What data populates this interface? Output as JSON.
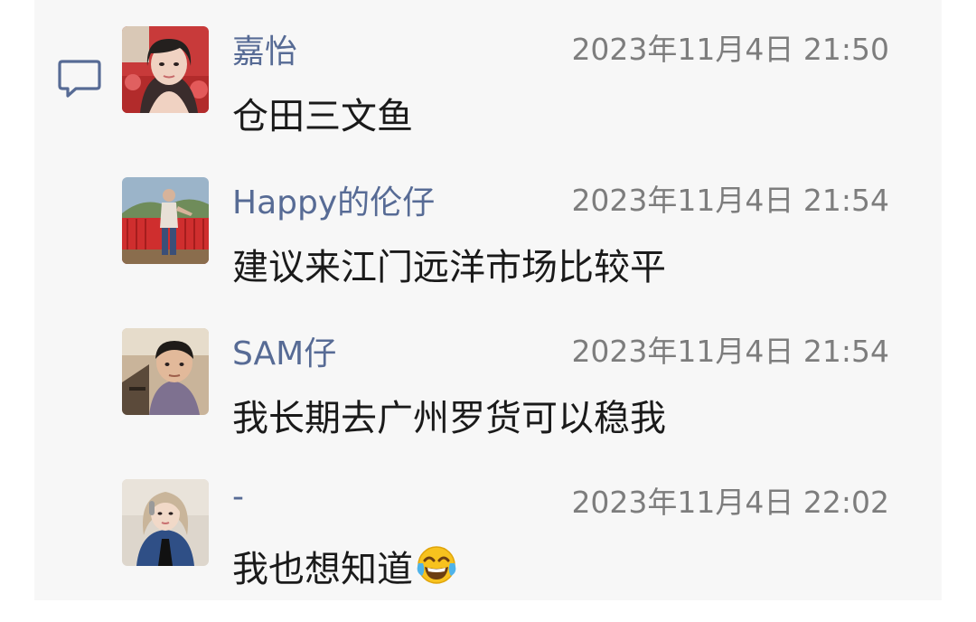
{
  "comments": [
    {
      "name": "嘉怡",
      "time": "2023年11月4日 21:50",
      "text": "仓田三文鱼",
      "avatar": "avatar-woman-dark-hair"
    },
    {
      "name": "Happy的伦仔",
      "time": "2023年11月4日 21:54",
      "text": "建议来江门远洋市场比较平",
      "avatar": "avatar-man-red-ribbons"
    },
    {
      "name": "SAM仔",
      "time": "2023年11月4日 21:54",
      "text": "我长期去广州罗货可以稳我",
      "avatar": "avatar-man-purple-shirt"
    },
    {
      "name": "-",
      "time": "2023年11月4日 22:02",
      "text": "我也想知道",
      "emoji": "tears-of-joy-emoji",
      "avatar": "avatar-woman-light-hair"
    }
  ],
  "icons": {
    "section": "comment-bubble-icon"
  },
  "colors": {
    "name": "#576b95",
    "time": "#7d7d7d",
    "text": "#1a1a1a",
    "panel": "#f7f7f7"
  }
}
